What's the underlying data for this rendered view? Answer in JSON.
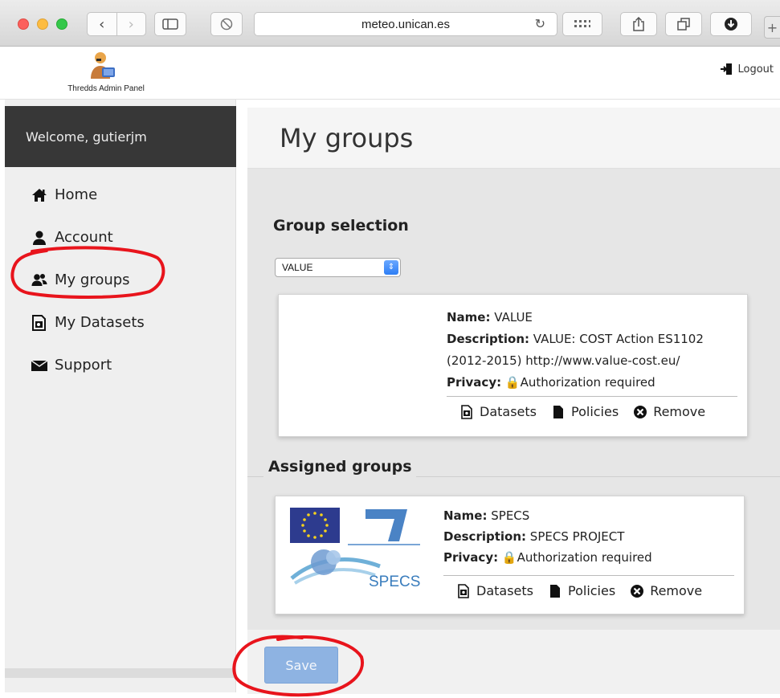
{
  "browser": {
    "url": "meteo.unican.es"
  },
  "header": {
    "logo_text": "Thredds Admin Panel",
    "logout_label": "Logout"
  },
  "sidebar": {
    "welcome": "Welcome, gutierjm",
    "items": [
      {
        "label": "Home",
        "icon": "home-icon"
      },
      {
        "label": "Account",
        "icon": "user-icon"
      },
      {
        "label": "My groups",
        "icon": "users-icon"
      },
      {
        "label": "My Datasets",
        "icon": "datasets-icon"
      },
      {
        "label": "Support",
        "icon": "envelope-icon"
      }
    ]
  },
  "main": {
    "title": "My groups",
    "group_selection": {
      "title": "Group selection",
      "selected": "VALUE",
      "card": {
        "name_label": "Name:",
        "name": "VALUE",
        "description_label": "Description:",
        "description": "VALUE: COST Action ES1102 (2012-2015) http://www.value-cost.eu/",
        "privacy_label": "Privacy:",
        "privacy": "Authorization required",
        "actions": [
          "Datasets",
          "Policies",
          "Remove"
        ]
      }
    },
    "assigned_groups": {
      "title": "Assigned groups",
      "card": {
        "logo_text": "SPECS",
        "name_label": "Name:",
        "name": "SPECS",
        "description_label": "Description:",
        "description": "SPECS PROJECT",
        "privacy_label": "Privacy:",
        "privacy": "Authorization required",
        "actions": [
          "Datasets",
          "Policies",
          "Remove"
        ]
      }
    },
    "save_label": "Save"
  },
  "colors": {
    "sidebar_dark": "#373737",
    "save_button": "#8eb3e2",
    "annotation_red": "#e8141c"
  }
}
